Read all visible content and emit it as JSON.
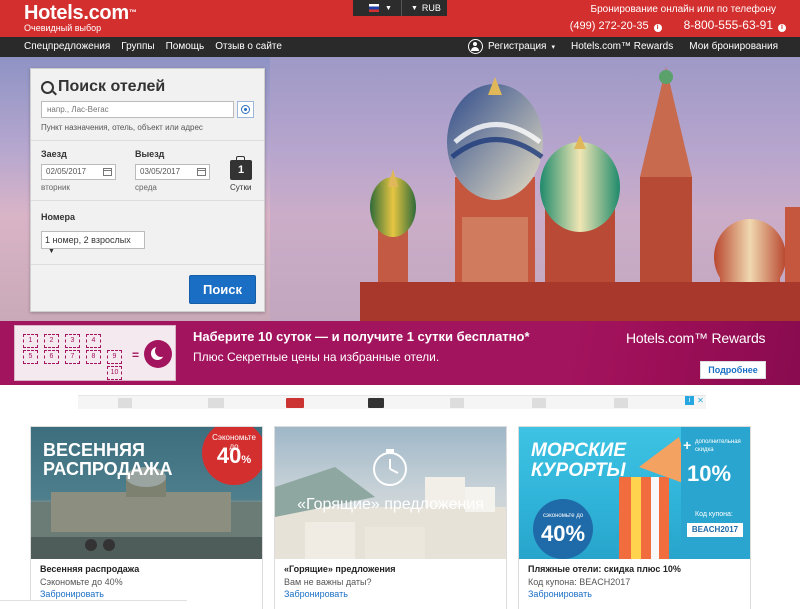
{
  "header": {
    "brand": "Hotels.com",
    "brand_tm": "™",
    "tagline": "Очевидный выбор",
    "currency": "RUB",
    "flag_icon": "ru-flag-icon",
    "phone_title": "Бронирование онлайн или по телефону",
    "phone_1": "(499) 272-20-35",
    "phone_2": "8-800-555-63-91"
  },
  "nav": {
    "left": [
      "Спецпредложения",
      "Группы",
      "Помощь",
      "Отзыв о сайте"
    ],
    "register": "Регистрация",
    "rewards": "Hotels.com™ Rewards",
    "bookings": "Мои бронирования"
  },
  "search": {
    "title": "Поиск отелей",
    "dest_placeholder": "напр., Лас-Вегас",
    "dest_hint": "Пункт назначения, отель, объект или адрес",
    "checkin_label": "Заезд",
    "checkin_value": "02/05/2017",
    "checkin_day": "вторник",
    "checkout_label": "Выезд",
    "checkout_value": "03/05/2017",
    "checkout_day": "среда",
    "nights": "1",
    "nights_label": "Сутки",
    "rooms_label": "Номера",
    "rooms_value": "1 номер, 2 взрослых",
    "submit": "Поиск"
  },
  "rewards_banner": {
    "stamps": [
      "1",
      "2",
      "3",
      "4",
      "5",
      "6",
      "7",
      "8",
      "9",
      "10"
    ],
    "equals": "=",
    "title": "Наберите 10 суток — и получите 1 сутки бесплатно*",
    "subtitle": "Плюс Секретные цены на избранные отели.",
    "logo": "Hotels.com",
    "logo_suffix": "™ Rewards",
    "button": "Подробнее"
  },
  "ad": {
    "info": "i",
    "close": "✕"
  },
  "cards": [
    {
      "image_headline_1": "ВЕСЕННЯЯ",
      "image_headline_2": "РАСПРОДАЖА",
      "badge_small": "Сэкономьте до",
      "badge_big": "40",
      "badge_pct": "%",
      "title": "Весенняя распродажа",
      "subtitle": "Сэкономьте до 40%",
      "link": "Забронировать"
    },
    {
      "image_headline": "«Горящие» предложения",
      "title": "«Горящие» предложения",
      "subtitle": "Вам не важны даты?",
      "link": "Забронировать"
    },
    {
      "image_headline_1": "МОРСКИЕ",
      "image_headline_2": "КУРОРТЫ",
      "extra_plus": "+",
      "extra_small": "дополнительная скидка",
      "extra_big": "10%",
      "badge_small": "сэкономьте до",
      "badge_big": "40%",
      "code_label": "Код купона:",
      "code": "BEACH2017",
      "title": "Пляжные отели: скидка плюс 10%",
      "subtitle": "Код купона: BEACH2017",
      "link": "Забронировать"
    }
  ],
  "colors": {
    "brand_red": "#d32f2f",
    "nav_dark": "#2a2a2a",
    "rewards_magenta": "#a3145e",
    "button_blue": "#1a6fc4"
  }
}
